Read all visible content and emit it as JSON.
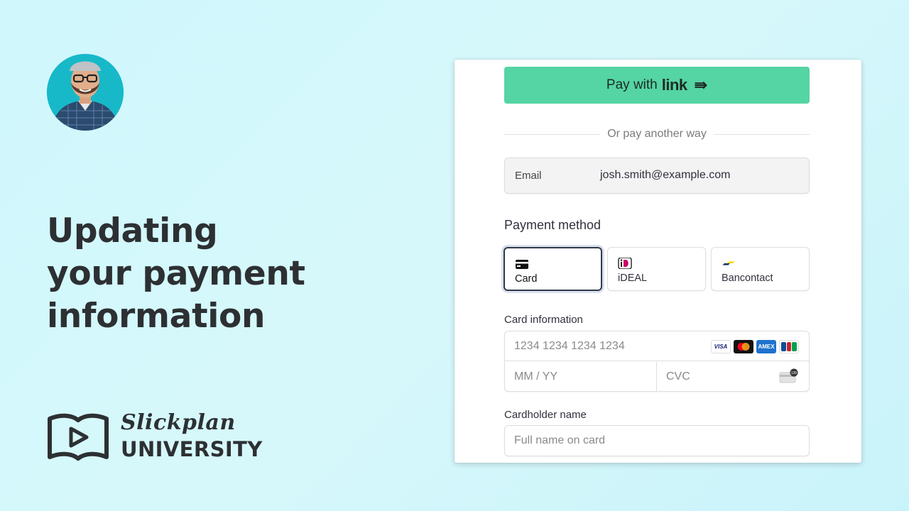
{
  "headline": [
    "Updating",
    "your payment",
    "information"
  ],
  "brand": {
    "script": "Slickplan",
    "word": "UNIVERSITY"
  },
  "checkout": {
    "pay_link_prefix": "Pay with",
    "pay_link_brand": "link",
    "divider": "Or pay another way",
    "email_label": "Email",
    "email_value": "josh.smith@example.com",
    "payment_method_title": "Payment method",
    "methods": [
      {
        "label": "Card",
        "icon": "card-icon",
        "selected": true
      },
      {
        "label": "iDEAL",
        "icon": "ideal-icon",
        "selected": false
      },
      {
        "label": "Bancontact",
        "icon": "bancontact-icon",
        "selected": false
      }
    ],
    "card_info_label": "Card information",
    "card_number_placeholder": "1234 1234 1234 1234",
    "card_brands": [
      "VISA",
      "mastercard",
      "AMEX",
      "JCB"
    ],
    "expiry_placeholder": "MM / YY",
    "cvc_placeholder": "CVC",
    "cvc_hint": "135",
    "cardholder_label": "Cardholder name",
    "cardholder_placeholder": "Full name on card"
  },
  "colors": {
    "link_button": "#55d4a4",
    "background": "#cff7fc",
    "text_dark": "#2d3033",
    "avatar_bg": "#17b9c9"
  }
}
